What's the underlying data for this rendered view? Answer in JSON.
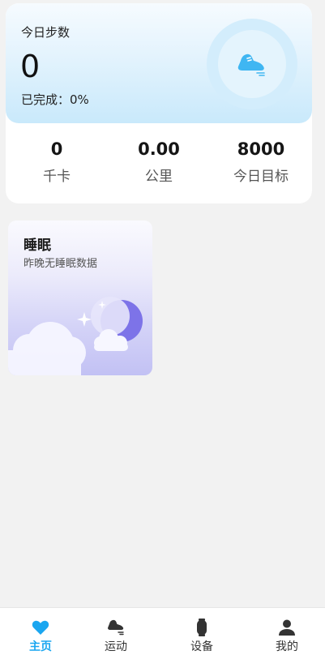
{
  "steps_card": {
    "label": "今日步数",
    "value": "0",
    "completion": "已完成：0%",
    "stats": [
      {
        "value": "0",
        "label": "千卡"
      },
      {
        "value": "0.00",
        "label": "公里"
      },
      {
        "value": "8000",
        "label": "今日目标"
      }
    ],
    "icon": "running-shoe-icon",
    "accent_color": "#3fb6f2"
  },
  "sleep_card": {
    "title": "睡眠",
    "subtitle": "昨晚无睡眠数据",
    "icon": "moon-cloud-illustration",
    "accent_color": "#7d73e8"
  },
  "bottom_nav": {
    "active_index": 0,
    "active_color": "#1aa6f0",
    "items": [
      {
        "label": "主页",
        "icon": "heart-icon"
      },
      {
        "label": "运动",
        "icon": "running-shoe-icon"
      },
      {
        "label": "设备",
        "icon": "watch-icon"
      },
      {
        "label": "我的",
        "icon": "person-icon"
      }
    ]
  }
}
